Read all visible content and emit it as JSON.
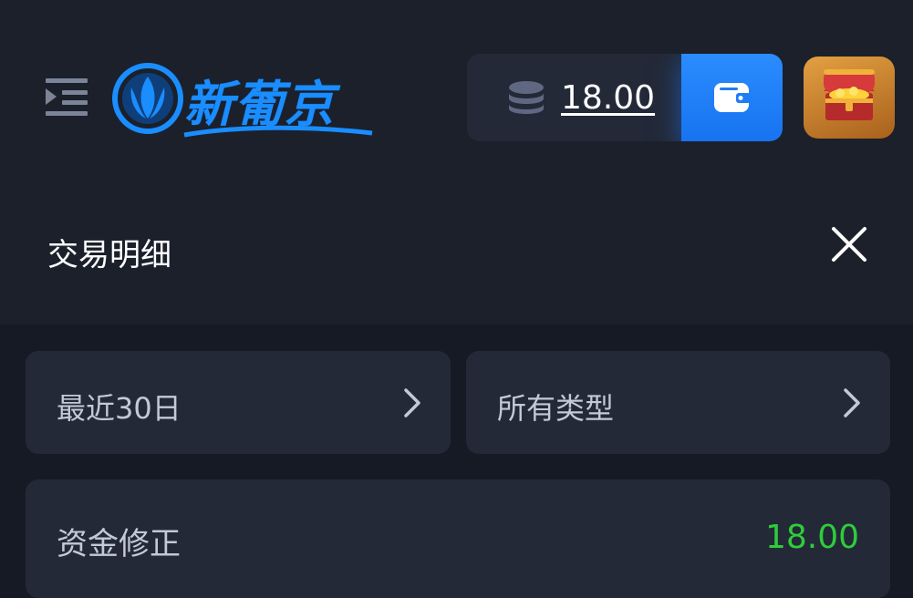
{
  "header": {
    "logo_text": "新葡京",
    "balance": "18.00"
  },
  "page": {
    "title": "交易明细"
  },
  "filters": {
    "date_range": "最近30日",
    "type": "所有类型"
  },
  "records": [
    {
      "type": "资金修正",
      "amount": "18.00"
    }
  ],
  "colors": {
    "accent_blue": "#1a8dff",
    "positive_amount": "#2ecc3b",
    "panel": "#232937",
    "background": "#161a24"
  },
  "icons": {
    "menu": "menu-collapse-icon",
    "coins": "coin-stack-icon",
    "wallet": "wallet-icon",
    "chest": "treasure-chest-icon",
    "close": "close-icon",
    "chevron": "chevron-right-icon"
  }
}
